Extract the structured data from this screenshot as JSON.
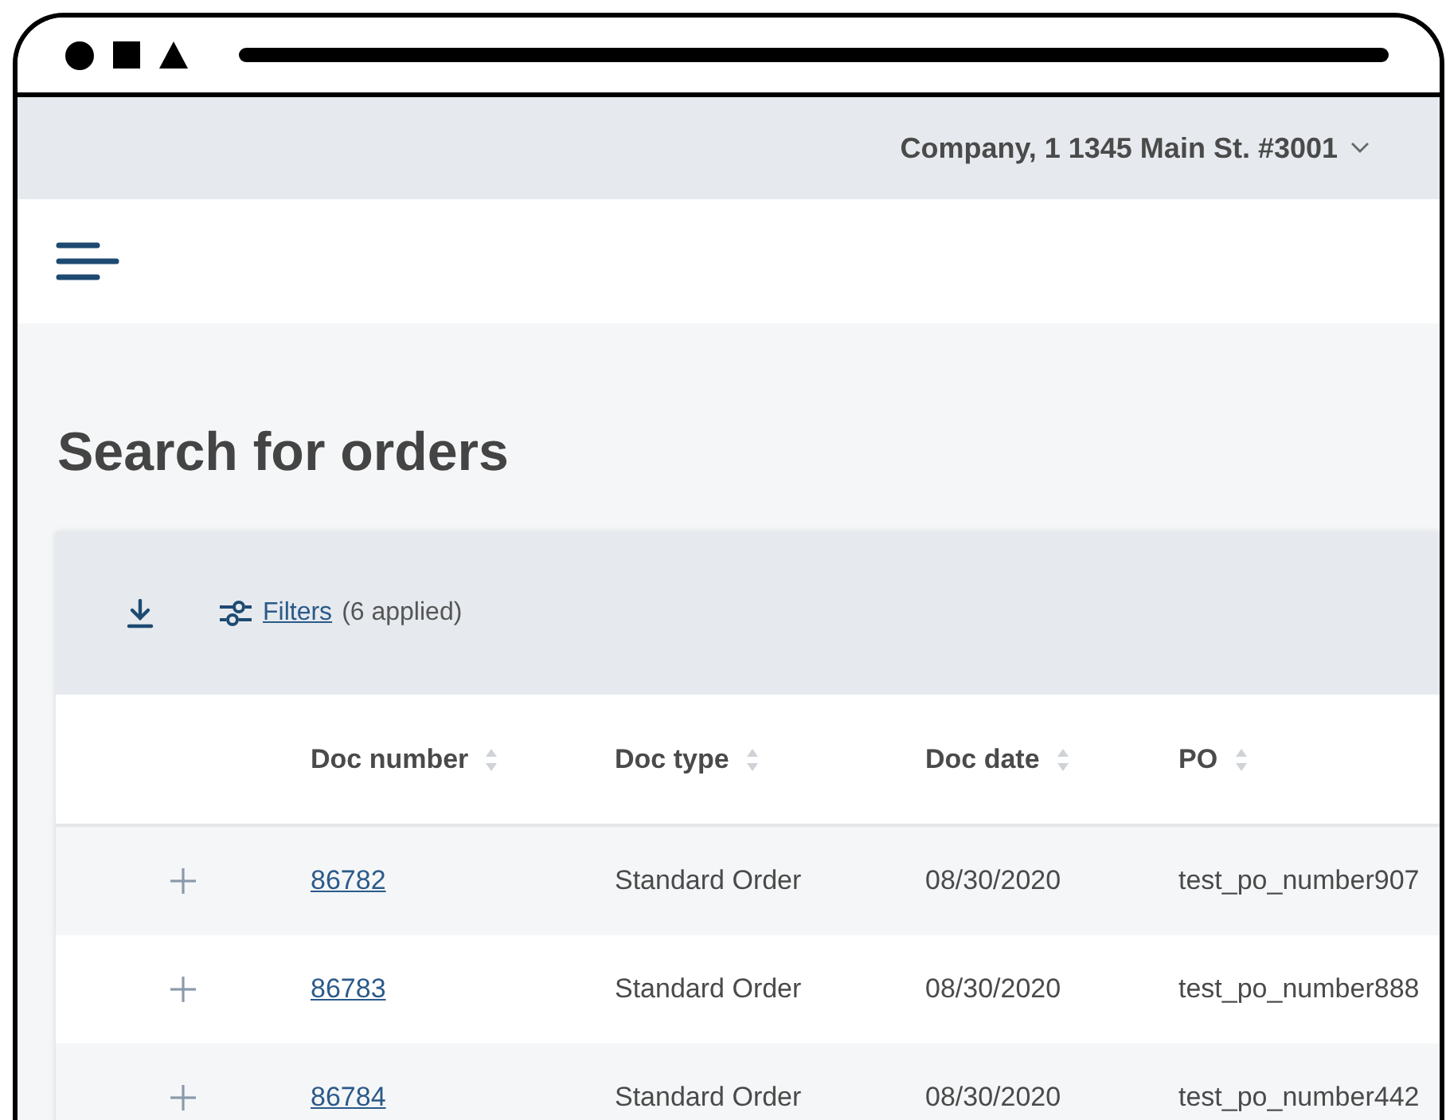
{
  "account_selector": {
    "label": "Company, 1 1345 Main St. #3001"
  },
  "page_title": "Search for orders",
  "toolbar": {
    "filters_link": "Filters",
    "filters_count": "(6 applied)"
  },
  "table": {
    "columns": [
      {
        "label": "Doc number"
      },
      {
        "label": "Doc type"
      },
      {
        "label": "Doc date"
      },
      {
        "label": "PO"
      }
    ],
    "rows": [
      {
        "expanded": false,
        "doc_number": "86782",
        "doc_type": "Standard Order",
        "doc_date": "08/30/2020",
        "po": "test_po_number907"
      },
      {
        "expanded": false,
        "doc_number": "86783",
        "doc_type": "Standard Order",
        "doc_date": "08/30/2020",
        "po": "test_po_number888"
      },
      {
        "expanded": false,
        "doc_number": "86784",
        "doc_type": "Standard Order",
        "doc_date": "08/30/2020",
        "po": "test_po_number442"
      }
    ]
  }
}
